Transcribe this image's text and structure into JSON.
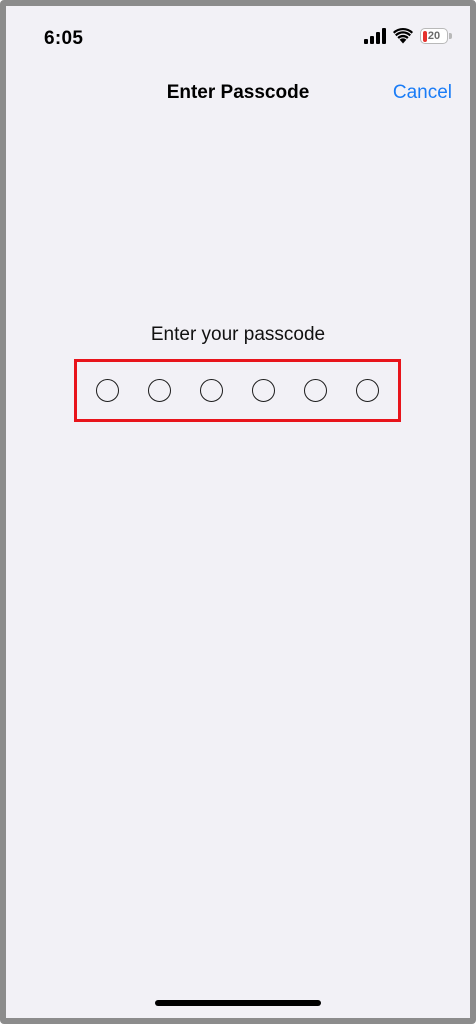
{
  "status_bar": {
    "time": "6:05",
    "battery_level": "20",
    "battery_fraction": 0.2
  },
  "nav": {
    "title": "Enter Passcode",
    "cancel_label": "Cancel"
  },
  "passcode": {
    "prompt": "Enter your passcode",
    "digit_count": 6
  },
  "colors": {
    "background": "#f2f1f6",
    "accent": "#1a7cf6",
    "highlight": "#e8141b",
    "battery_low": "#e5322d"
  }
}
